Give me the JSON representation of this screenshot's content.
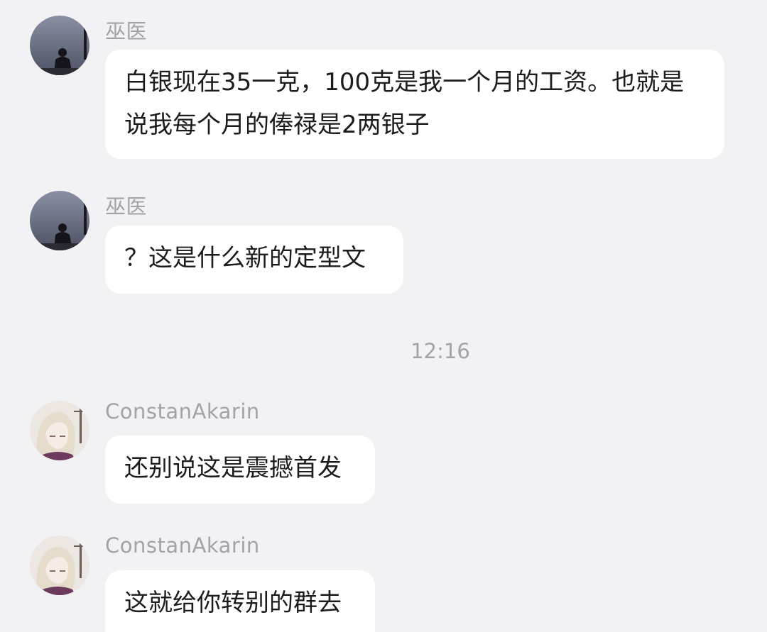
{
  "messages": [
    {
      "sender": "巫医",
      "text": "白银现在35一克，100克是我一个月的工资。也就是说我每个月的俸禄是2两银子",
      "avatar_icon": "silhouette-avatar-icon"
    },
    {
      "sender": "巫医",
      "text": "？这是什么新的定型文",
      "avatar_icon": "silhouette-avatar-icon"
    },
    {
      "sender": "ConstanAkarin",
      "text": "还别说这是震撼首发",
      "avatar_icon": "anime-girl-avatar-icon"
    },
    {
      "sender": "ConstanAkarin",
      "text": "这就给你转别的群去",
      "avatar_icon": "anime-girl-avatar-icon"
    }
  ],
  "timestamp": "12:16",
  "colors": {
    "background": "#f2f2f4",
    "bubble": "#ffffff",
    "text": "#1c1c1e",
    "meta_text": "#a3a3a7"
  }
}
